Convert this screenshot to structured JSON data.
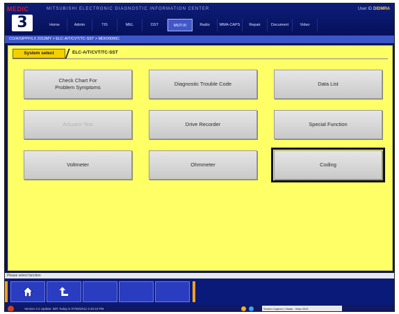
{
  "app": {
    "logo": "MEDIC",
    "title": "MITSUBISHI ELECTRONIC DIAGNOSTIC INFORMATION CENTER",
    "user_id_label": "User ID",
    "user_id_value": "DIDMRA",
    "big_number": "3"
  },
  "nav": {
    "tabs": [
      {
        "label": "Home"
      },
      {
        "label": "Admin"
      },
      {
        "label": "TIS"
      },
      {
        "label": "MEL"
      },
      {
        "label": "DST"
      },
      {
        "label": "MUT-III",
        "active": true
      },
      {
        "label": "Radio"
      },
      {
        "label": "MMA-CAPS"
      },
      {
        "label": "Repair"
      },
      {
        "label": "Document"
      },
      {
        "label": "Video"
      }
    ]
  },
  "breadcrumb": "CO/A/SIPPF/LX 2012MY  >  ELC-A/T/CVT/TC-SST  >  MDIO0000C",
  "panel": {
    "tab_system_select": "System select",
    "tab_current": "ELC-A/T/CVT/TC-SST"
  },
  "buttons": [
    {
      "label": "Check Chart For\nProblem Symptoms",
      "state": "enabled"
    },
    {
      "label": "Diagnostic Trouble Code",
      "state": "enabled"
    },
    {
      "label": "Data List",
      "state": "enabled"
    },
    {
      "label": "Actuator Test",
      "state": "disabled"
    },
    {
      "label": "Drive Recorder",
      "state": "enabled"
    },
    {
      "label": "Special Function",
      "state": "enabled"
    },
    {
      "label": "Voltmeter",
      "state": "enabled"
    },
    {
      "label": "Ohmmeter",
      "state": "enabled"
    },
    {
      "label": "Coding",
      "state": "selected"
    }
  ],
  "status_message": "Please select function",
  "toolbar": {
    "icons": [
      "home-icon",
      "back-icon"
    ]
  },
  "taskbar": {
    "version": "Version 3.2    Update: IDR    Today is 07/26/2012 2:40:10 PM",
    "tray_text": "Screen Capture  |  Vistas - Vista 2012"
  },
  "colors": {
    "panel_bg": "#ffff66",
    "frame_bg": "#0a1450",
    "tab_accent": "#f4d000",
    "toolbar_accent": "#f0a020"
  }
}
